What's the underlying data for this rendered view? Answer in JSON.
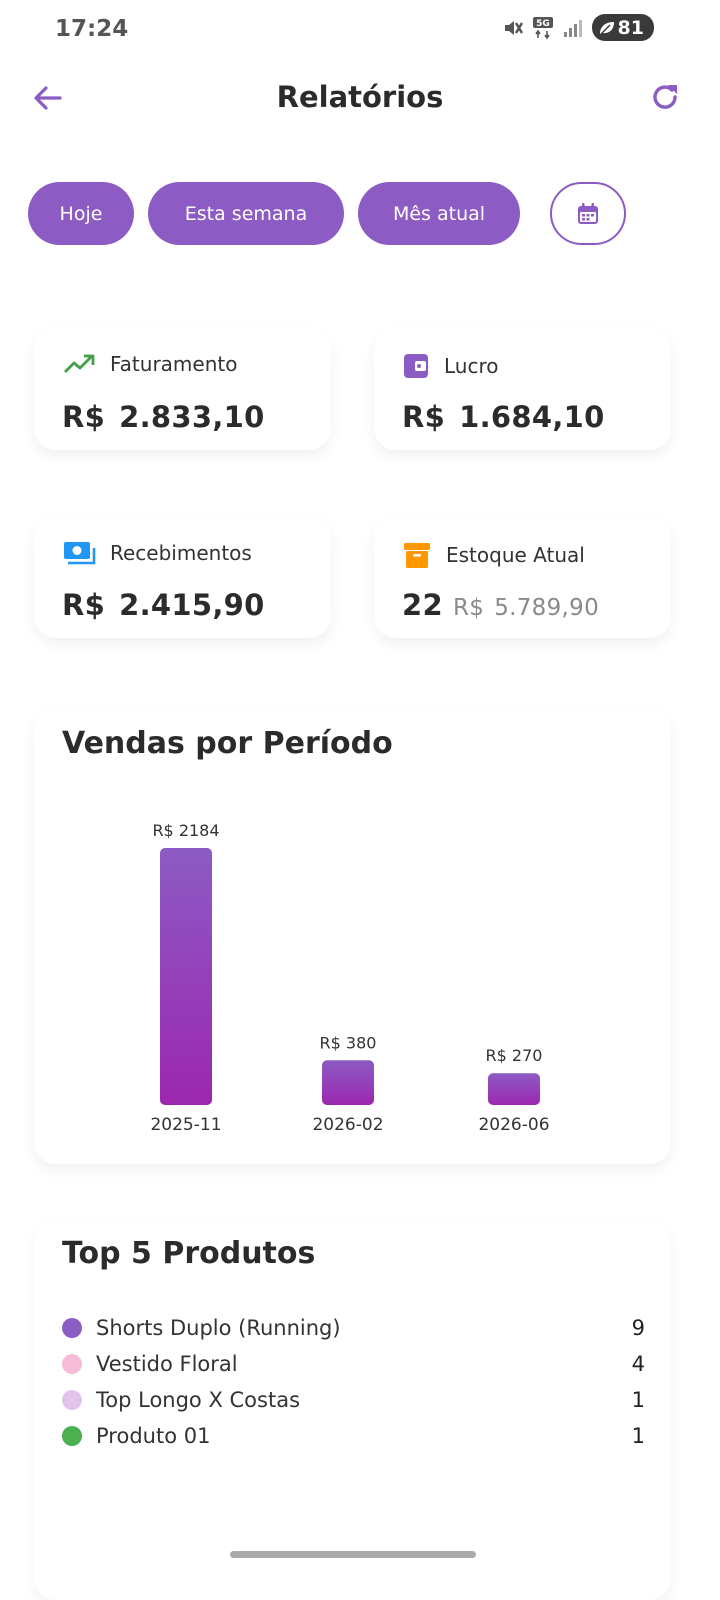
{
  "status_bar": {
    "time": "17:24",
    "network": "5G",
    "battery": "81",
    "icons": [
      "mute-vibrate-icon",
      "5g-icon",
      "signal-icon",
      "battery-icon"
    ]
  },
  "header": {
    "title": "Relatórios",
    "back_icon": "arrow-left-icon",
    "refresh_icon": "refresh-icon"
  },
  "filters": {
    "today": "Hoje",
    "week": "Esta semana",
    "month": "Mês atual",
    "calendar_icon": "calendar-icon"
  },
  "stats": {
    "revenue": {
      "label": "Faturamento",
      "currency": "R$",
      "value": "2.833,10",
      "icon": "trending-up-icon"
    },
    "profit": {
      "label": "Lucro",
      "currency": "R$",
      "value": "1.684,10",
      "icon": "wallet-icon"
    },
    "receipts": {
      "label": "Recebimentos",
      "currency": "R$",
      "value": "2.415,90",
      "icon": "money-icon"
    },
    "stock": {
      "label": "Estoque Atual",
      "quantity": "22",
      "currency": "R$",
      "value": "5.789,90",
      "icon": "archive-icon"
    }
  },
  "sales_chart": {
    "title": "Vendas por Período"
  },
  "chart_data": {
    "type": "bar",
    "title": "Vendas por Período",
    "categories": [
      "2025-11",
      "2026-02",
      "2026-06"
    ],
    "values": [
      2184,
      380,
      270
    ],
    "data_labels": [
      "R$ 2184",
      "R$ 380",
      "R$ 270"
    ],
    "xlabel": "",
    "ylabel": "",
    "ylim": [
      0,
      2184
    ],
    "grid": false,
    "colors": {
      "bar_top": "#8c5bc3",
      "bar_bottom": "#9c27b0"
    }
  },
  "top_products": {
    "title": "Top 5 Produtos",
    "items": [
      {
        "name": "Shorts Duplo (Running)",
        "qty": "9",
        "color": "#8a5cc4"
      },
      {
        "name": "Vestido Floral",
        "qty": "4",
        "color": "#f6bcd8"
      },
      {
        "name": "Top Longo X Costas",
        "qty": "1",
        "color": "#e2c4ea"
      },
      {
        "name": "Produto 01",
        "qty": "1",
        "color": "#4caf50"
      }
    ]
  },
  "colors": {
    "accent": "#8c5bc3",
    "text": "#2b2b2b",
    "muted": "#8a8a8a"
  }
}
